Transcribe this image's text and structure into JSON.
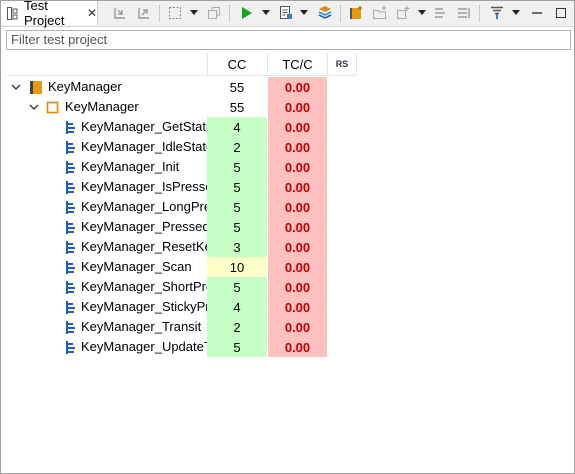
{
  "tab": {
    "title": "Test Project",
    "close": "✕"
  },
  "toolbar": {
    "buttons": [
      "import-icon",
      "export-icon",
      "select-icon",
      "copy-icon",
      "run-icon",
      "report-icon",
      "stack-icon",
      "add-suite-icon",
      "add-folder-icon",
      "add-test-icon",
      "reorder-icon",
      "move-icon",
      "filter-icon",
      "minimize-icon",
      "maximize-icon"
    ]
  },
  "filter": {
    "placeholder": "Filter test project"
  },
  "columns": {
    "cc": "CC",
    "tc": "TC/C",
    "rs": "RS"
  },
  "colors": {
    "green": "#c6ffc6",
    "yellow": "#ffffc8",
    "red": "#ffc0c0",
    "red_text": "#c00000"
  },
  "rows": [
    {
      "name": "KeyManager",
      "cc": "55",
      "tc": "0.00",
      "level": 0,
      "kind": "project"
    },
    {
      "name": "KeyManager",
      "cc": "55",
      "tc": "0.00",
      "level": 1,
      "kind": "module"
    },
    {
      "name": "KeyManager_GetStatu",
      "cc": "4",
      "tc": "0.00",
      "level": 2,
      "kind": "function",
      "cc_color": "green"
    },
    {
      "name": "KeyManager_IdleState",
      "cc": "2",
      "tc": "0.00",
      "level": 2,
      "kind": "function",
      "cc_color": "green"
    },
    {
      "name": "KeyManager_Init",
      "cc": "5",
      "tc": "0.00",
      "level": 2,
      "kind": "function",
      "cc_color": "green"
    },
    {
      "name": "KeyManager_IsPresse",
      "cc": "5",
      "tc": "0.00",
      "level": 2,
      "kind": "function",
      "cc_color": "green"
    },
    {
      "name": "KeyManager_LongPre",
      "cc": "5",
      "tc": "0.00",
      "level": 2,
      "kind": "function",
      "cc_color": "green"
    },
    {
      "name": "KeyManager_Pressed",
      "cc": "5",
      "tc": "0.00",
      "level": 2,
      "kind": "function",
      "cc_color": "green"
    },
    {
      "name": "KeyManager_ResetKe",
      "cc": "3",
      "tc": "0.00",
      "level": 2,
      "kind": "function",
      "cc_color": "green"
    },
    {
      "name": "KeyManager_Scan",
      "cc": "10",
      "tc": "0.00",
      "level": 2,
      "kind": "function",
      "cc_color": "yellow"
    },
    {
      "name": "KeyManager_ShortPre",
      "cc": "5",
      "tc": "0.00",
      "level": 2,
      "kind": "function",
      "cc_color": "green"
    },
    {
      "name": "KeyManager_StickyPre",
      "cc": "4",
      "tc": "0.00",
      "level": 2,
      "kind": "function",
      "cc_color": "green"
    },
    {
      "name": "KeyManager_Transit",
      "cc": "2",
      "tc": "0.00",
      "level": 2,
      "kind": "function",
      "cc_color": "green"
    },
    {
      "name": "KeyManager_UpdateT",
      "cc": "5",
      "tc": "0.00",
      "level": 2,
      "kind": "function",
      "cc_color": "green"
    }
  ]
}
